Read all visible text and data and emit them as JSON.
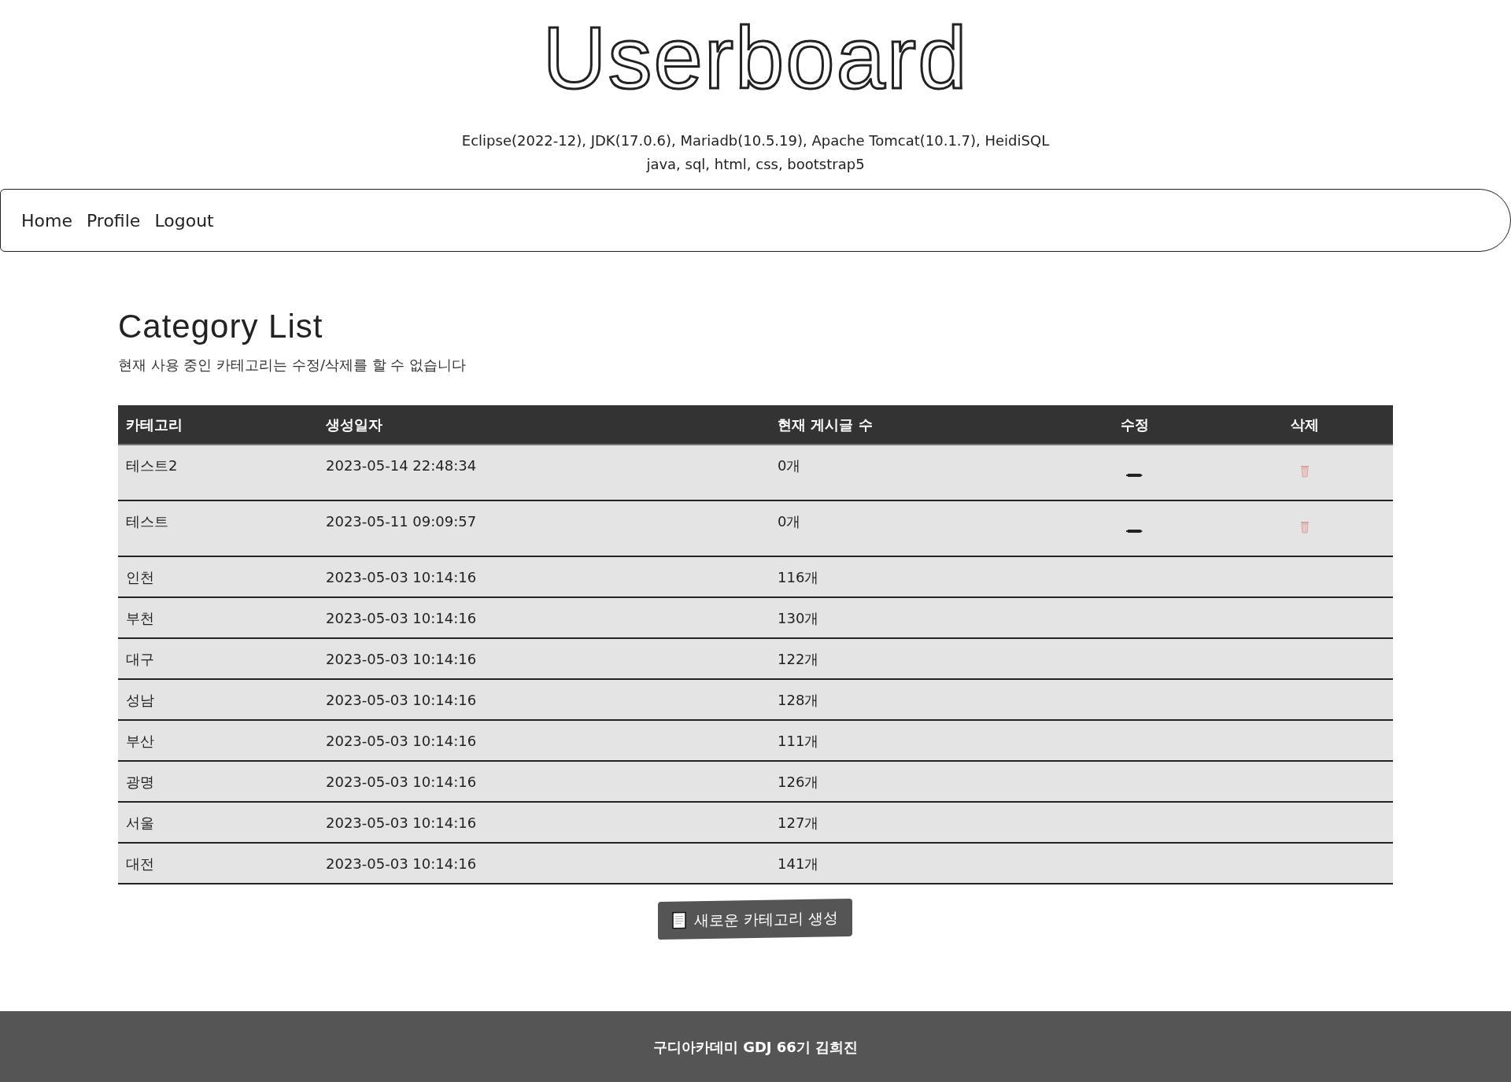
{
  "header": {
    "title": "Userboard",
    "lines": [
      "Eclipse(2022-12), JDK(17.0.6), Mariadb(10.5.19), Apache Tomcat(10.1.7), HeidiSQL",
      "java, sql, html, css, bootstrap5"
    ]
  },
  "nav": [
    "Home",
    "Profile",
    "Logout"
  ],
  "page": {
    "heading": "Category List",
    "note": "현재 사용 중인 카테고리는 수정/삭제를 할 수 없습니다"
  },
  "table": {
    "columns": [
      "카테고리",
      "생성일자",
      "현재 게시글 수",
      "수정",
      "삭제"
    ],
    "rows": [
      {
        "category": "테스트2",
        "created": "2023-05-14 22:48:34",
        "count": "0개",
        "actions": true
      },
      {
        "category": "테스트",
        "created": "2023-05-11 09:09:57",
        "count": "0개",
        "actions": true
      },
      {
        "category": "인천",
        "created": "2023-05-03 10:14:16",
        "count": "116개",
        "actions": false
      },
      {
        "category": "부천",
        "created": "2023-05-03 10:14:16",
        "count": "130개",
        "actions": false
      },
      {
        "category": "대구",
        "created": "2023-05-03 10:14:16",
        "count": "122개",
        "actions": false
      },
      {
        "category": "성남",
        "created": "2023-05-03 10:14:16",
        "count": "128개",
        "actions": false
      },
      {
        "category": "부산",
        "created": "2023-05-03 10:14:16",
        "count": "111개",
        "actions": false
      },
      {
        "category": "광명",
        "created": "2023-05-03 10:14:16",
        "count": "126개",
        "actions": false
      },
      {
        "category": "서울",
        "created": "2023-05-03 10:14:16",
        "count": "127개",
        "actions": false
      },
      {
        "category": "대전",
        "created": "2023-05-03 10:14:16",
        "count": "141개",
        "actions": false
      }
    ]
  },
  "create_button": "새로운 카테고리 생성",
  "footer": "구디아카데미 GDJ 66기 김희진"
}
